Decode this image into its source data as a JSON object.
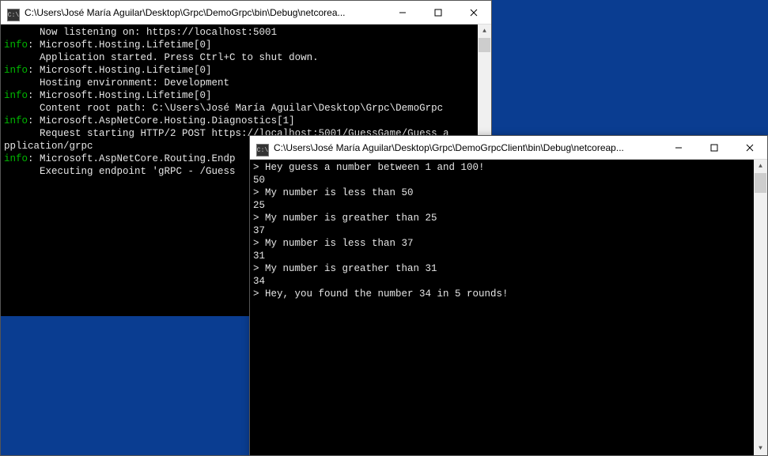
{
  "window_back": {
    "title": "C:\\Users\\José María Aguilar\\Desktop\\Grpc\\DemoGrpc\\bin\\Debug\\netcorea...",
    "icon_text": "C:\\",
    "lines": [
      {
        "pre": "      ",
        "cls": "white",
        "text": "Now listening on: https://localhost:5001"
      },
      {
        "pre": "",
        "cls": "info",
        "text": "info",
        "post": ": Microsoft.Hosting.Lifetime[0]"
      },
      {
        "pre": "      ",
        "cls": "white",
        "text": "Application started. Press Ctrl+C to shut down."
      },
      {
        "pre": "",
        "cls": "info",
        "text": "info",
        "post": ": Microsoft.Hosting.Lifetime[0]"
      },
      {
        "pre": "      ",
        "cls": "white",
        "text": "Hosting environment: Development"
      },
      {
        "pre": "",
        "cls": "info",
        "text": "info",
        "post": ": Microsoft.Hosting.Lifetime[0]"
      },
      {
        "pre": "      ",
        "cls": "white",
        "text": "Content root path: C:\\Users\\José María Aguilar\\Desktop\\Grpc\\DemoGrpc"
      },
      {
        "pre": "",
        "cls": "info",
        "text": "info",
        "post": ": Microsoft.AspNetCore.Hosting.Diagnostics[1]"
      },
      {
        "pre": "      ",
        "cls": "white",
        "text": "Request starting HTTP/2 POST https://localhost:5001/GuessGame/Guess a"
      },
      {
        "pre": "",
        "cls": "white",
        "text": "pplication/grpc"
      },
      {
        "pre": "",
        "cls": "info",
        "text": "info",
        "post": ": Microsoft.AspNetCore.Routing.Endp"
      },
      {
        "pre": "      ",
        "cls": "white",
        "text": "Executing endpoint 'gRPC - /Guess"
      }
    ]
  },
  "window_front": {
    "title": "C:\\Users\\José María Aguilar\\Desktop\\Grpc\\DemoGrpcClient\\bin\\Debug\\netcoreap...",
    "icon_text": "C:\\",
    "lines": [
      "> Hey guess a number between 1 and 100!",
      "50",
      "> My number is less than 50",
      "25",
      "> My number is greather than 25",
      "37",
      "> My number is less than 37",
      "31",
      "> My number is greather than 31",
      "34",
      "> Hey, you found the number 34 in 5 rounds!"
    ]
  }
}
